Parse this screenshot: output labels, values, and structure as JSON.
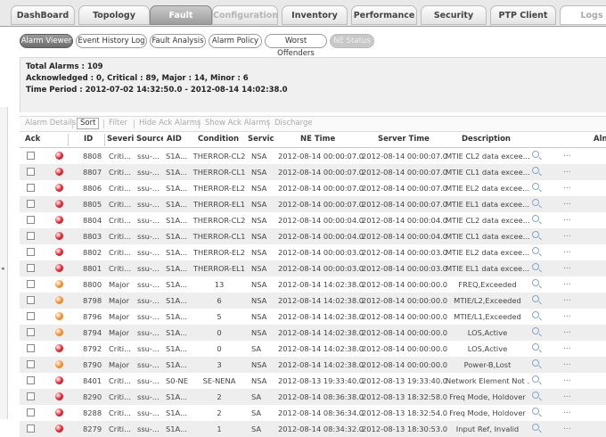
{
  "tabs": [
    {
      "label": "DashBoard",
      "state": "normal"
    },
    {
      "label": "Topology",
      "state": "normal"
    },
    {
      "label": "Fault",
      "state": "active"
    },
    {
      "label": "Configuration",
      "state": "disabled"
    },
    {
      "label": "Inventory",
      "state": "normal"
    },
    {
      "label": "Performance",
      "state": "normal"
    },
    {
      "label": "Security",
      "state": "normal"
    },
    {
      "label": "PTP Client",
      "state": "normal"
    },
    {
      "label": "Logs",
      "state": "white"
    }
  ],
  "subtabs": [
    {
      "label": "Alarm Viewer",
      "state": "active"
    },
    {
      "label": "Event History Log",
      "state": "normal"
    },
    {
      "label": "Fault Analysis",
      "state": "normal"
    },
    {
      "label": "Alarm Policy",
      "state": "normal"
    },
    {
      "label": "Worst Offenders",
      "state": "normal"
    },
    {
      "label": "NE Status",
      "state": "disabled"
    }
  ],
  "summary": {
    "total": "Total Alarms : 109",
    "ack": "Acknowledged : 0, Critical : 89, Major : 14, Minor : 6",
    "period": "Time Period : 2012-07-02 14:32:50.0 - 2012-08-14 14:02:38.0"
  },
  "actions": {
    "details": "Alarm Details",
    "sort": "Sort",
    "filter": "Filter",
    "hide_ack": "Hide Ack Alarms",
    "show_ack": "Show Ack Alarms",
    "discharge": "Discharge"
  },
  "columns": {
    "ack": "Ack",
    "id": "ID",
    "severity": "Severi",
    "source": "Source",
    "aid": "AID",
    "condition": "Condition",
    "service": "Servic",
    "ne_time": "NE Time",
    "server_time": "Server Time",
    "description": "Description",
    "alarm": "Aln"
  },
  "colors": {
    "critical": "#d8202a",
    "major": "#ef8a2b",
    "accent": "#8c8c8c"
  },
  "rows": [
    {
      "id": "8808",
      "sev": "Criti...",
      "src": "ssu-...",
      "aid": "S1A...",
      "cond": "THERROR-CL2",
      "svc": "NSA",
      "ne": "2012-08-14 00:00:07.0",
      "srv": "2012-08-14 00:00:07.0",
      "desc": "MTIE CL2 data excee...",
      "level": "critical"
    },
    {
      "id": "8807",
      "sev": "Criti...",
      "src": "ssu-...",
      "aid": "S1A...",
      "cond": "THERROR-CL1",
      "svc": "NSA",
      "ne": "2012-08-14 00:00:07.0",
      "srv": "2012-08-14 00:00:07.0",
      "desc": "MTIE CL1 data excee...",
      "level": "critical"
    },
    {
      "id": "8806",
      "sev": "Criti...",
      "src": "ssu-...",
      "aid": "S1A...",
      "cond": "THERROR-EL2",
      "svc": "NSA",
      "ne": "2012-08-14 00:00:07.0",
      "srv": "2012-08-14 00:00:07.0",
      "desc": "MTIE EL2 data excee...",
      "level": "critical"
    },
    {
      "id": "8805",
      "sev": "Criti...",
      "src": "ssu-...",
      "aid": "S1A...",
      "cond": "THERROR-EL1",
      "svc": "NSA",
      "ne": "2012-08-14 00:00:07.0",
      "srv": "2012-08-14 00:00:07.0",
      "desc": "MTIE EL1 data excee...",
      "level": "critical"
    },
    {
      "id": "8804",
      "sev": "Criti...",
      "src": "ssu-...",
      "aid": "S1A...",
      "cond": "THERROR-CL2",
      "svc": "NSA",
      "ne": "2012-08-14 00:00:04.0",
      "srv": "2012-08-14 00:00:04.0",
      "desc": "MTIE CL2 data excee...",
      "level": "critical"
    },
    {
      "id": "8803",
      "sev": "Criti...",
      "src": "ssu-...",
      "aid": "S1A...",
      "cond": "THERROR-CL1",
      "svc": "NSA",
      "ne": "2012-08-14 00:00:04.0",
      "srv": "2012-08-14 00:00:04.0",
      "desc": "MTIE CL1 data excee...",
      "level": "critical"
    },
    {
      "id": "8802",
      "sev": "Criti...",
      "src": "ssu-...",
      "aid": "S1A...",
      "cond": "THERROR-EL2",
      "svc": "NSA",
      "ne": "2012-08-14 00:00:03.0",
      "srv": "2012-08-14 00:00:03.0",
      "desc": "MTIE EL2 data excee...",
      "level": "critical"
    },
    {
      "id": "8801",
      "sev": "Criti...",
      "src": "ssu-...",
      "aid": "S1A...",
      "cond": "THERROR-EL1",
      "svc": "NSA",
      "ne": "2012-08-14 00:00:03.0",
      "srv": "2012-08-14 00:00:03.0",
      "desc": "MTIE EL1 data excee...",
      "level": "critical"
    },
    {
      "id": "8800",
      "sev": "Major",
      "src": "ssu-...",
      "aid": "S1A...",
      "cond": "13",
      "svc": "NSA",
      "ne": "2012-08-14 14:02:38.0",
      "srv": "2012-08-14 00:00:00.0",
      "desc": "FREQ,Exceeded",
      "level": "major"
    },
    {
      "id": "8798",
      "sev": "Major",
      "src": "ssu-...",
      "aid": "S1A...",
      "cond": "6",
      "svc": "NSA",
      "ne": "2012-08-14 14:02:38.0",
      "srv": "2012-08-14 00:00:00.0",
      "desc": "MTIE/L2,Exceeded",
      "level": "major"
    },
    {
      "id": "8796",
      "sev": "Major",
      "src": "ssu-...",
      "aid": "S1A...",
      "cond": "5",
      "svc": "NSA",
      "ne": "2012-08-14 14:02:38.0",
      "srv": "2012-08-14 00:00:00.0",
      "desc": "MTIE/L1,Exceeded",
      "level": "major"
    },
    {
      "id": "8794",
      "sev": "Major",
      "src": "ssu-...",
      "aid": "S1A...",
      "cond": "0",
      "svc": "NSA",
      "ne": "2012-08-14 14:02:38.0",
      "srv": "2012-08-14 00:00:00.0",
      "desc": "LOS,Active",
      "level": "major"
    },
    {
      "id": "8792",
      "sev": "Criti...",
      "src": "ssu-...",
      "aid": "S1A...",
      "cond": "0",
      "svc": "SA",
      "ne": "2012-08-14 14:02:38.0",
      "srv": "2012-08-14 00:00:00.0",
      "desc": "LOS,Active",
      "level": "critical"
    },
    {
      "id": "8790",
      "sev": "Major",
      "src": "ssu-...",
      "aid": "S1A...",
      "cond": "3",
      "svc": "NSA",
      "ne": "2012-08-14 14:02:38.0",
      "srv": "2012-08-14 00:00:00.0",
      "desc": "Power-B,Lost",
      "level": "major"
    },
    {
      "id": "8401",
      "sev": "Criti...",
      "src": "ssu-...",
      "aid": "S0-NE",
      "cond": "SE-NENA",
      "svc": "NSA",
      "ne": "2012-08-13 19:33:40.0",
      "srv": "2012-08-13 19:33:40.0",
      "desc": "Network Element Not ...",
      "level": "critical"
    },
    {
      "id": "8290",
      "sev": "Criti...",
      "src": "ssu-...",
      "aid": "S1A...",
      "cond": "2",
      "svc": "SA",
      "ne": "2012-08-14 08:36:38.0",
      "srv": "2012-08-13 18:32:58.0",
      "desc": "Freq Mode, Holdover",
      "level": "critical"
    },
    {
      "id": "8288",
      "sev": "Criti...",
      "src": "ssu-...",
      "aid": "S1A...",
      "cond": "2",
      "svc": "SA",
      "ne": "2012-08-14 08:36:34.0",
      "srv": "2012-08-13 18:32:54.0",
      "desc": "Freq Mode, Holdover",
      "level": "critical"
    },
    {
      "id": "8279",
      "sev": "Criti...",
      "src": "ssu-...",
      "aid": "S1A...",
      "cond": "1",
      "svc": "SA",
      "ne": "2012-08-14 08:34:32.0",
      "srv": "2012-08-13 18:30:53.0",
      "desc": "Input Ref, Invalid",
      "level": "critical"
    }
  ]
}
